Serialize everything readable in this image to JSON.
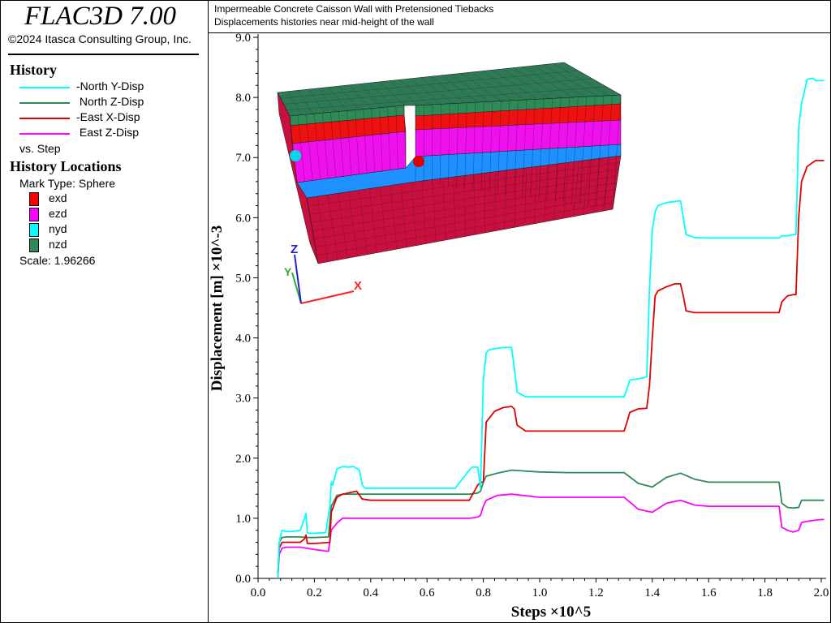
{
  "app": {
    "title": "FLAC3D 7.00",
    "copyright": "©2024 Itasca Consulting Group, Inc."
  },
  "header": {
    "line1": "Impermeable Concrete Caisson Wall with Pretensioned Tiebacks",
    "line2": "Displacements histories near mid-height of the wall"
  },
  "history": {
    "heading": "History",
    "items": [
      {
        "label": "-North Y-Disp",
        "color": "#00ffff"
      },
      {
        "label": " North Z-Disp",
        "color": "#2e8b57"
      },
      {
        "label": "-East X-Disp",
        "color": "#e00000"
      },
      {
        "label": " East Z-Disp",
        "color": "#ff00ff"
      }
    ],
    "vs": "vs. Step"
  },
  "history_locations": {
    "heading": "History Locations",
    "mark_type": "Mark Type: Sphere",
    "marks": [
      {
        "label": "exd",
        "color": "#ff0000"
      },
      {
        "label": "ezd",
        "color": "#ff00ff"
      },
      {
        "label": "nyd",
        "color": "#00ffff"
      },
      {
        "label": "nzd",
        "color": "#2e8b57"
      }
    ],
    "scale": "Scale: 1.96266"
  },
  "model_view": {
    "axis_labels": {
      "x": "X",
      "y": "Y",
      "z": "Z"
    },
    "layer_colors": {
      "top": "#2f7a56",
      "green_band": "#2e8b57",
      "red_band": "#ee1111",
      "magenta_band": "#ee11ee",
      "blue_band": "#1e90ff",
      "base": "#c8103f"
    },
    "sphere_colors": {
      "north": "#00d8e8",
      "east": "#dd0000"
    }
  },
  "chart_data": {
    "type": "line",
    "xlabel": "Steps ×10^5",
    "ylabel": "Displacement [m] ×10^-3",
    "xlim": [
      0.0,
      2.0
    ],
    "ylim": [
      0.0,
      9.0
    ],
    "x_ticks": [
      "0.0",
      "0.2",
      "0.4",
      "0.6",
      "0.8",
      "1.0",
      "1.2",
      "1.4",
      "1.6",
      "1.8",
      "2.0"
    ],
    "y_ticks": [
      "0.0",
      "1.0",
      "2.0",
      "3.0",
      "4.0",
      "5.0",
      "6.0",
      "7.0",
      "8.0",
      "9.0"
    ],
    "grid": false,
    "series": [
      {
        "name": "-North Y-Disp",
        "color": "#00ffff",
        "x": [
          0.07,
          0.075,
          0.085,
          0.1,
          0.12,
          0.15,
          0.165,
          0.17,
          0.175,
          0.18,
          0.2,
          0.24,
          0.255,
          0.26,
          0.265,
          0.28,
          0.3,
          0.32,
          0.34,
          0.36,
          0.37,
          0.38,
          0.4,
          0.5,
          0.6,
          0.7,
          0.75,
          0.76,
          0.78,
          0.79,
          0.8,
          0.81,
          0.82,
          0.84,
          0.87,
          0.9,
          0.91,
          0.92,
          0.95,
          1.0,
          1.1,
          1.2,
          1.3,
          1.31,
          1.32,
          1.35,
          1.38,
          1.39,
          1.4,
          1.41,
          1.42,
          1.45,
          1.48,
          1.5,
          1.51,
          1.52,
          1.55,
          1.6,
          1.7,
          1.8,
          1.85,
          1.86,
          1.88,
          1.9,
          1.91,
          1.92,
          1.93,
          1.95,
          1.97,
          1.98,
          2.0,
          2.01
        ],
        "y": [
          0.0,
          0.6,
          0.8,
          0.78,
          0.78,
          0.8,
          1.0,
          1.08,
          0.76,
          0.75,
          0.75,
          0.76,
          1.2,
          1.6,
          1.55,
          1.82,
          1.86,
          1.85,
          1.86,
          1.8,
          1.55,
          1.5,
          1.5,
          1.5,
          1.5,
          1.5,
          1.8,
          1.85,
          1.85,
          1.5,
          3.3,
          3.75,
          3.8,
          3.82,
          3.84,
          3.84,
          3.5,
          3.1,
          3.02,
          3.02,
          3.02,
          3.02,
          3.02,
          3.15,
          3.3,
          3.32,
          3.35,
          4.8,
          5.8,
          6.1,
          6.2,
          6.25,
          6.27,
          6.28,
          6.0,
          5.72,
          5.67,
          5.66,
          5.66,
          5.66,
          5.66,
          5.7,
          5.7,
          5.72,
          5.72,
          7.5,
          7.9,
          8.3,
          8.32,
          8.28,
          8.28,
          8.28
        ]
      },
      {
        "name": " North Z-Disp",
        "color": "#2e8b57",
        "x": [
          0.07,
          0.075,
          0.085,
          0.1,
          0.15,
          0.17,
          0.2,
          0.25,
          0.26,
          0.28,
          0.3,
          0.4,
          0.5,
          0.6,
          0.7,
          0.75,
          0.78,
          0.79,
          0.8,
          0.81,
          0.85,
          0.9,
          1.0,
          1.1,
          1.2,
          1.3,
          1.35,
          1.4,
          1.45,
          1.5,
          1.55,
          1.6,
          1.7,
          1.8,
          1.85,
          1.86,
          1.88,
          1.9,
          1.92,
          1.93,
          1.95,
          2.0,
          2.01
        ],
        "y": [
          0.0,
          0.6,
          0.68,
          0.69,
          0.69,
          0.68,
          0.68,
          0.69,
          1.2,
          1.38,
          1.4,
          1.4,
          1.4,
          1.4,
          1.4,
          1.4,
          1.42,
          1.45,
          1.6,
          1.7,
          1.75,
          1.8,
          1.77,
          1.76,
          1.76,
          1.76,
          1.58,
          1.52,
          1.68,
          1.75,
          1.65,
          1.6,
          1.6,
          1.6,
          1.6,
          1.25,
          1.18,
          1.17,
          1.18,
          1.3,
          1.3,
          1.3,
          1.3
        ]
      },
      {
        "name": "-East X-Disp",
        "color": "#e00000",
        "x": [
          0.07,
          0.075,
          0.085,
          0.1,
          0.15,
          0.165,
          0.17,
          0.175,
          0.2,
          0.255,
          0.26,
          0.28,
          0.3,
          0.35,
          0.37,
          0.4,
          0.5,
          0.6,
          0.7,
          0.75,
          0.78,
          0.79,
          0.8,
          0.81,
          0.84,
          0.87,
          0.9,
          0.91,
          0.92,
          0.95,
          1.0,
          1.1,
          1.2,
          1.3,
          1.31,
          1.32,
          1.35,
          1.38,
          1.39,
          1.4,
          1.41,
          1.42,
          1.45,
          1.48,
          1.5,
          1.51,
          1.52,
          1.55,
          1.6,
          1.7,
          1.8,
          1.85,
          1.86,
          1.88,
          1.9,
          1.91,
          1.92,
          1.93,
          1.95,
          1.97,
          1.98,
          2.0,
          2.01
        ],
        "y": [
          0.0,
          0.5,
          0.6,
          0.6,
          0.6,
          0.66,
          0.72,
          0.58,
          0.58,
          0.6,
          1.1,
          1.35,
          1.4,
          1.45,
          1.32,
          1.3,
          1.3,
          1.3,
          1.3,
          1.3,
          1.55,
          1.6,
          1.6,
          2.6,
          2.78,
          2.84,
          2.86,
          2.82,
          2.55,
          2.45,
          2.45,
          2.45,
          2.45,
          2.45,
          2.6,
          2.76,
          2.82,
          2.83,
          3.2,
          4.0,
          4.7,
          4.78,
          4.85,
          4.9,
          4.9,
          4.7,
          4.45,
          4.42,
          4.42,
          4.42,
          4.42,
          4.42,
          4.6,
          4.7,
          4.72,
          4.72,
          6.0,
          6.6,
          6.85,
          6.92,
          6.95,
          6.95,
          6.95
        ]
      },
      {
        "name": " East Z-Disp",
        "color": "#ff00ff",
        "x": [
          0.07,
          0.075,
          0.085,
          0.1,
          0.15,
          0.2,
          0.25,
          0.26,
          0.28,
          0.3,
          0.4,
          0.5,
          0.6,
          0.7,
          0.75,
          0.78,
          0.79,
          0.8,
          0.81,
          0.85,
          0.9,
          1.0,
          1.1,
          1.2,
          1.3,
          1.35,
          1.4,
          1.45,
          1.5,
          1.55,
          1.6,
          1.7,
          1.8,
          1.85,
          1.86,
          1.88,
          1.9,
          1.92,
          1.93,
          1.95,
          2.0,
          2.01
        ],
        "y": [
          0.0,
          0.4,
          0.5,
          0.52,
          0.52,
          0.48,
          0.45,
          0.8,
          0.92,
          1.0,
          1.0,
          1.0,
          1.0,
          1.0,
          1.0,
          1.02,
          1.05,
          1.2,
          1.3,
          1.38,
          1.4,
          1.35,
          1.35,
          1.35,
          1.35,
          1.15,
          1.1,
          1.25,
          1.3,
          1.22,
          1.2,
          1.2,
          1.2,
          1.2,
          0.85,
          0.8,
          0.77,
          0.8,
          0.93,
          0.95,
          0.98,
          0.98
        ]
      }
    ]
  }
}
